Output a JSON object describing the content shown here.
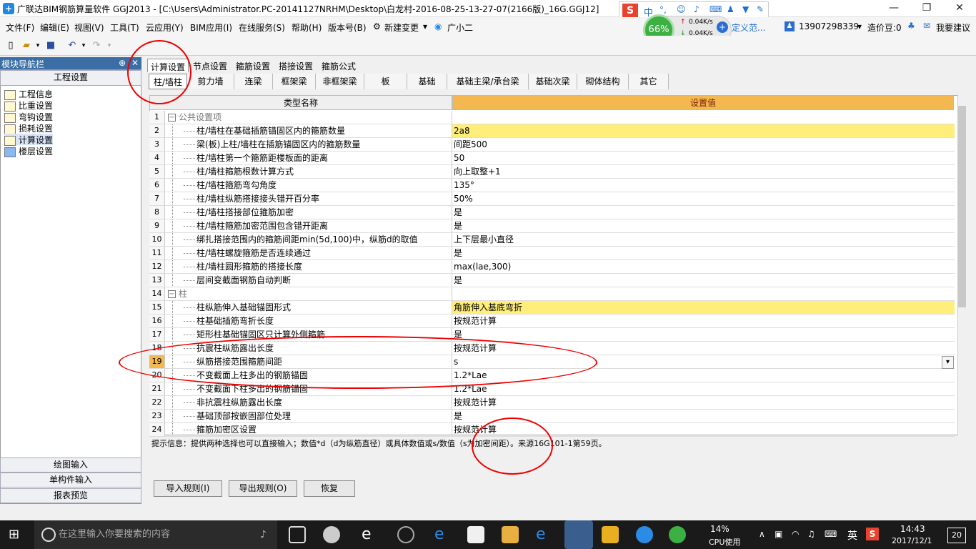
{
  "title": "广联达BIM钢筋算量软件 GGJ2013 - [C:\\Users\\Administrator.PC-20141127NRHM\\Desktop\\白龙村-2016-08-25-13-27-07(2166版)_16G.GGJ12]",
  "menu": [
    "文件(F)",
    "编辑(E)",
    "视图(V)",
    "工具(T)",
    "云应用(Y)",
    "BIM应用(I)",
    "在线服务(S)",
    "帮助(H)",
    "版本号(B)",
    "新建变更",
    "广小二"
  ],
  "ime": {
    "lang": "中"
  },
  "speed": {
    "percent": "66%",
    "up": "0.04K/s",
    "down": "0.04K/s",
    "extra": "定义范..."
  },
  "account": {
    "phone": "13907298339",
    "coin": "造价豆:0",
    "suggest": "我要建议"
  },
  "left": {
    "header": "模块导航栏",
    "section": "工程设置",
    "items": [
      "工程信息",
      "比重设置",
      "弯钩设置",
      "损耗设置",
      "计算设置",
      "楼层设置"
    ],
    "bottom": [
      "绘图输入",
      "单构件输入",
      "报表预览"
    ]
  },
  "tabs1": [
    "计算设置",
    "节点设置",
    "箍筋设置",
    "搭接设置",
    "箍筋公式"
  ],
  "tabs2": [
    "柱/墙柱",
    "剪力墙",
    "连梁",
    "框架梁",
    "非框架梁",
    "板",
    "基础",
    "基础主梁/承台梁",
    "基础次梁",
    "砌体结构",
    "其它"
  ],
  "grid": {
    "col_name": "类型名称",
    "col_val": "设置值",
    "rows": [
      {
        "n": "1",
        "name": "公共设置项",
        "val": "",
        "group": true
      },
      {
        "n": "2",
        "name": "柱/墙柱在基础插筋锚固区内的箍筋数量",
        "val": "2a8",
        "hl": true
      },
      {
        "n": "3",
        "name": "梁(板)上柱/墙柱在插筋锚固区内的箍筋数量",
        "val": "间距500"
      },
      {
        "n": "4",
        "name": "柱/墙柱第一个箍筋距楼板面的距离",
        "val": "50"
      },
      {
        "n": "5",
        "name": "柱/墙柱箍筋根数计算方式",
        "val": "向上取整+1"
      },
      {
        "n": "6",
        "name": "柱/墙柱箍筋弯勾角度",
        "val": "135°"
      },
      {
        "n": "7",
        "name": "柱/墙柱纵筋搭接接头错开百分率",
        "val": "50%"
      },
      {
        "n": "8",
        "name": "柱/墙柱搭接部位箍筋加密",
        "val": "是"
      },
      {
        "n": "9",
        "name": "柱/墙柱箍筋加密范围包含错开距离",
        "val": "是"
      },
      {
        "n": "10",
        "name": "绑扎搭接范围内的箍筋间距min(5d,100)中，纵筋d的取值",
        "val": "上下层最小直径"
      },
      {
        "n": "11",
        "name": "柱/墙柱螺旋箍筋是否连续通过",
        "val": "是"
      },
      {
        "n": "12",
        "name": "柱/墙柱圆形箍筋的搭接长度",
        "val": "max(lae,300)"
      },
      {
        "n": "13",
        "name": "层间变截面钢筋自动判断",
        "val": "是"
      },
      {
        "n": "14",
        "name": "柱",
        "val": "",
        "group": true
      },
      {
        "n": "15",
        "name": "柱纵筋伸入基础锚固形式",
        "val": "角筋伸入基底弯折",
        "hl": true
      },
      {
        "n": "16",
        "name": "柱基础插筋弯折长度",
        "val": "按规范计算"
      },
      {
        "n": "17",
        "name": "矩形柱基础锚固区只计算外侧箍筋",
        "val": "是"
      },
      {
        "n": "18",
        "name": "抗震柱纵筋露出长度",
        "val": "按规范计算"
      },
      {
        "n": "19",
        "name": "纵筋搭接范围箍筋间距",
        "val": "s",
        "sel": true
      },
      {
        "n": "20",
        "name": "不变截面上柱多出的钢筋锚固",
        "val": "1.2*Lae"
      },
      {
        "n": "21",
        "name": "不变截面下柱多出的钢筋锚固",
        "val": "1.2*Lae"
      },
      {
        "n": "22",
        "name": "非抗震柱纵筋露出长度",
        "val": "按规范计算"
      },
      {
        "n": "23",
        "name": "基础顶部按嵌固部位处理",
        "val": "是"
      },
      {
        "n": "24",
        "name": "箍筋加密区设置",
        "val": "按规范计算"
      }
    ]
  },
  "hint": "提示信息：提供两种选择也可以直接输入；数值*d（d为纵筋直径）或具体数值或s/数值（s为加密间距）。来源16G101-1第59页。",
  "buttons": [
    "导入规则(I)",
    "导出规则(O)",
    "恢复"
  ],
  "taskbar": {
    "search": "在这里输入你要搜索的内容",
    "cpu": "14%",
    "cpu_label": "CPU使用",
    "ime": "英",
    "time": "14:43",
    "date": "2017/12/1",
    "notif": "20"
  }
}
